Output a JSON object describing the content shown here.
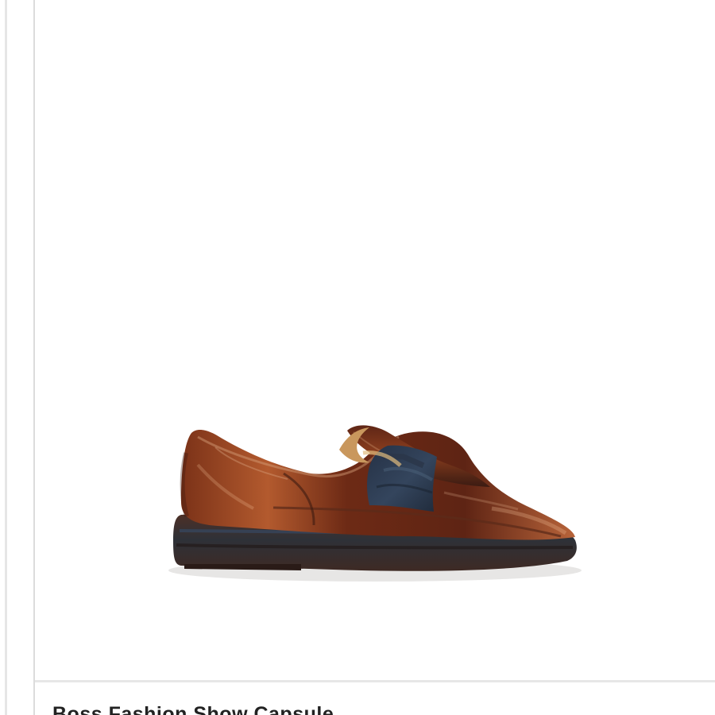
{
  "product": {
    "title": "Boss Fashion Show Capsule",
    "image_icon": "loafer-shoe-image",
    "colors": {
      "leather": "#6b2e17",
      "leather_highlight": "#b8643a",
      "strap": "#2d3a4d",
      "sole": "#3b2a22",
      "divider": "#e7e7e7",
      "background": "#ffffff"
    }
  }
}
